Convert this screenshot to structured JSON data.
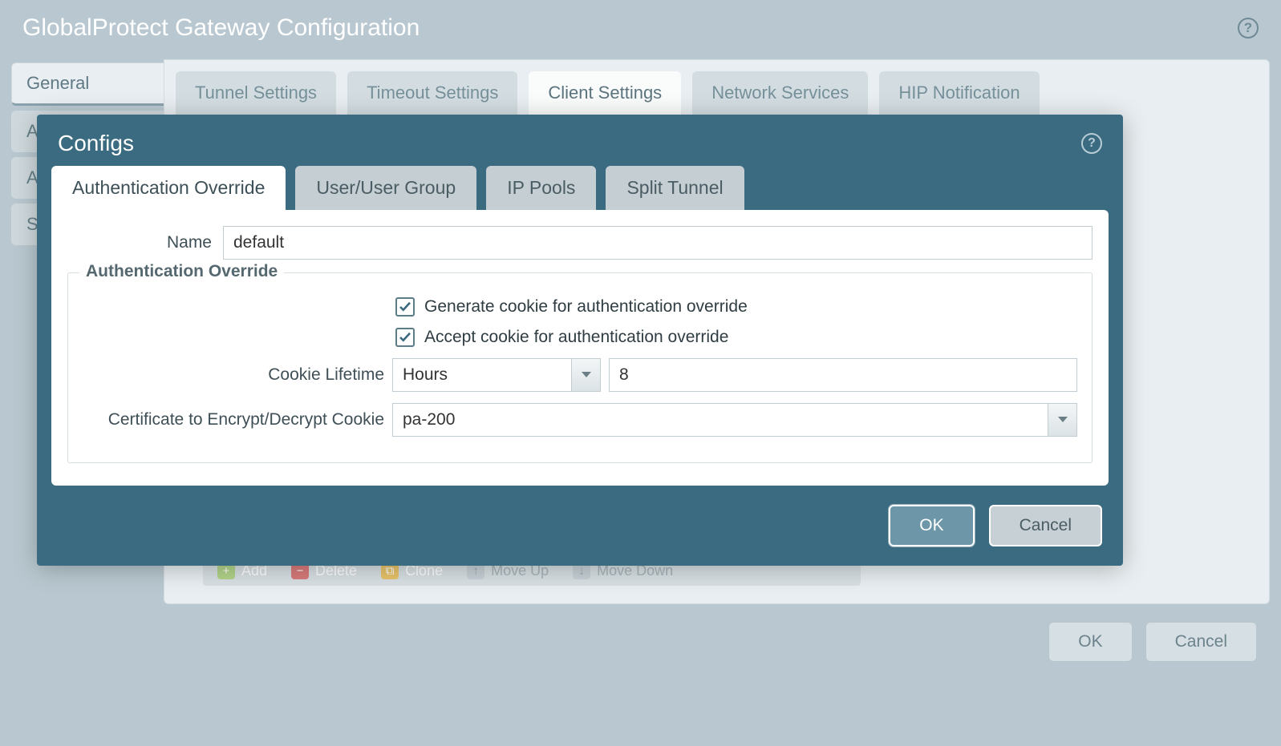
{
  "outer": {
    "title": "GlobalProtect Gateway Configuration",
    "sidebar": [
      {
        "label": "General",
        "active": true
      },
      {
        "label": "Authentication",
        "active": false
      },
      {
        "label": "Agent",
        "active": false
      },
      {
        "label": "Satellite",
        "active": false
      }
    ],
    "top_tabs": [
      {
        "label": "Tunnel Settings",
        "active": false
      },
      {
        "label": "Timeout Settings",
        "active": false
      },
      {
        "label": "Client Settings",
        "active": true
      },
      {
        "label": "Network Services",
        "active": false
      },
      {
        "label": "HIP Notification",
        "active": false
      }
    ],
    "grid_actions": {
      "add": "Add",
      "delete": "Delete",
      "clone": "Clone",
      "move_up": "Move Up",
      "move_down": "Move Down"
    },
    "buttons": {
      "ok": "OK",
      "cancel": "Cancel"
    }
  },
  "modal": {
    "title": "Configs",
    "tabs": [
      {
        "label": "Authentication Override",
        "active": true
      },
      {
        "label": "User/User Group",
        "active": false
      },
      {
        "label": "IP Pools",
        "active": false
      },
      {
        "label": "Split Tunnel",
        "active": false
      }
    ],
    "name_label": "Name",
    "name_value": "default",
    "fieldset_legend": "Authentication Override",
    "generate_cookie_label": "Generate cookie for authentication override",
    "generate_cookie_checked": true,
    "accept_cookie_label": "Accept cookie for authentication override",
    "accept_cookie_checked": true,
    "cookie_lifetime_label": "Cookie Lifetime",
    "cookie_lifetime_unit": "Hours",
    "cookie_lifetime_value": "8",
    "cert_label": "Certificate to Encrypt/Decrypt Cookie",
    "cert_value": "pa-200",
    "buttons": {
      "ok": "OK",
      "cancel": "Cancel"
    }
  }
}
